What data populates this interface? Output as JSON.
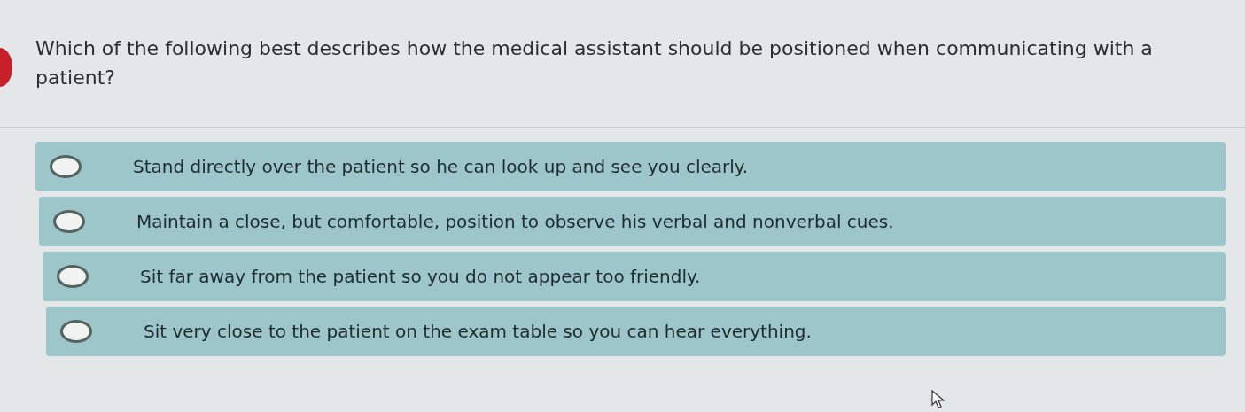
{
  "question": {
    "text": "Which of the following best describes how the medical assistant should be positioned when communicating with a patient?"
  },
  "options": [
    {
      "text": "Stand directly over the patient so he can look up and see you clearly.",
      "selected": false
    },
    {
      "text": "Maintain a close, but comfortable, position to observe his verbal and nonverbal cues.",
      "selected": false
    },
    {
      "text": "Sit far away from the patient so you do not appear too friendly.",
      "selected": false
    },
    {
      "text": "Sit very close to the patient on the exam table so you can hear everything.",
      "selected": false
    }
  ]
}
